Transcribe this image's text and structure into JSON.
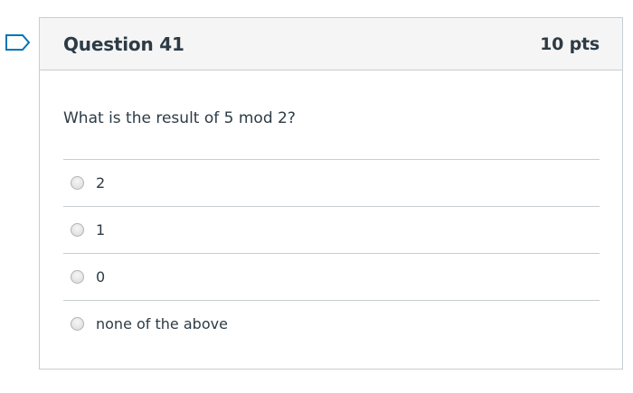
{
  "question": {
    "title": "Question 41",
    "points": "10 pts",
    "text": "What is the result of 5 mod 2?",
    "answers": [
      {
        "label": "2",
        "selected": false
      },
      {
        "label": "1",
        "selected": false
      },
      {
        "label": "0",
        "selected": false
      },
      {
        "label": "none of the above",
        "selected": false
      }
    ]
  },
  "icons": {
    "flag": "flag-question-icon"
  },
  "colors": {
    "accent": "#0374b5",
    "text": "#2d3b45",
    "border": "#c7cdd1",
    "header_bg": "#f5f5f5"
  }
}
